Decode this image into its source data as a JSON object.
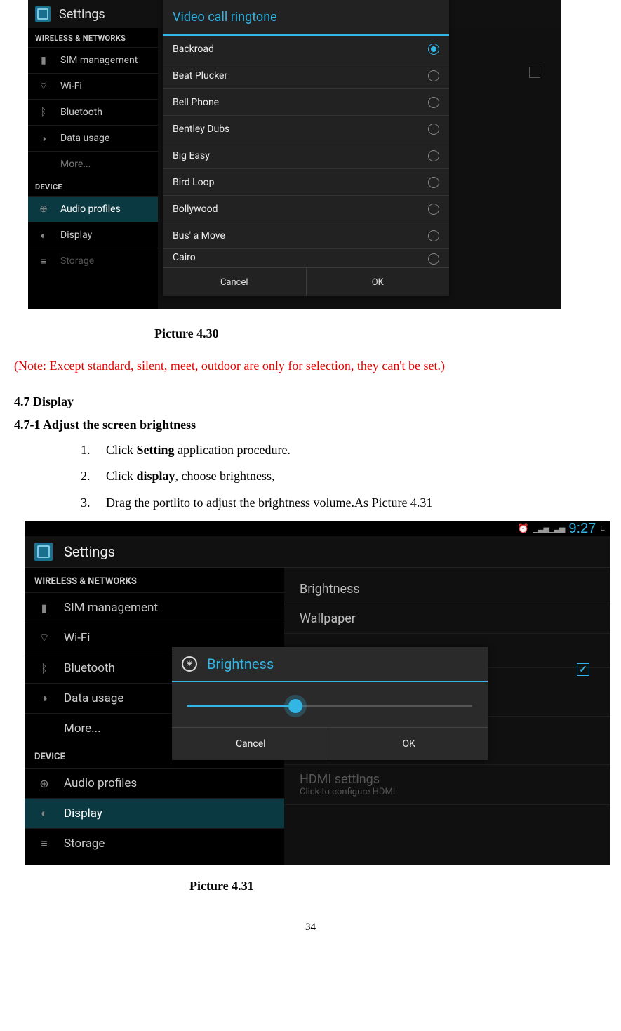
{
  "fig430": {
    "app_title": "Settings",
    "sections": {
      "wireless": "WIRELESS & NETWORKS",
      "device": "DEVICE"
    },
    "sidebar": [
      "SIM management",
      "Wi-Fi",
      "Bluetooth",
      "Data usage",
      "More...",
      "Audio profiles",
      "Display",
      "Storage"
    ],
    "dialog_title": "Video call ringtone",
    "ringtones": [
      "Backroad",
      "Beat Plucker",
      "Bell Phone",
      "Bentley Dubs",
      "Big Easy",
      "Bird Loop",
      "Bollywood",
      "Bus' a Move",
      "Cairo"
    ],
    "selected": "Backroad",
    "cancel": "Cancel",
    "ok": "OK"
  },
  "caption430": "Picture 4.30",
  "note_text": "(Note: Except standard, silent, meet, outdoor are only for selection, they can't be set.)",
  "section47": "4.7 Display",
  "section471": "4.7-1 Adjust the screen brightness",
  "steps": {
    "s1_n": "1.",
    "s1_pre": "Click ",
    "s1_b": "Setting",
    "s1_post": " application procedure.",
    "s2_n": "2.",
    "s2_pre": "Click ",
    "s2_b": "display",
    "s2_post": ", choose brightness,",
    "s3_n": "3.",
    "s3_txt": "Drag the portlito to adjust the brightness volume.As Picture 4.31"
  },
  "fig431": {
    "app_title": "Settings",
    "time": "9:27",
    "sections": {
      "wireless": "WIRELESS & NETWORKS",
      "device": "DEVICE"
    },
    "sidebar": [
      "SIM management",
      "Wi-Fi",
      "Bluetooth",
      "Data usage",
      "More...",
      "Audio profiles",
      "Display",
      "Storage"
    ],
    "right_labels": {
      "brightness": "Brightness",
      "wallpaper": "Wallpaper",
      "hdmi": "HDMI settings",
      "hdmi_sub": "Click to configure HDMI"
    },
    "dialog_title": "Brightness",
    "cancel": "Cancel",
    "ok": "OK"
  },
  "caption431": "Picture 4.31",
  "page_number": "34"
}
